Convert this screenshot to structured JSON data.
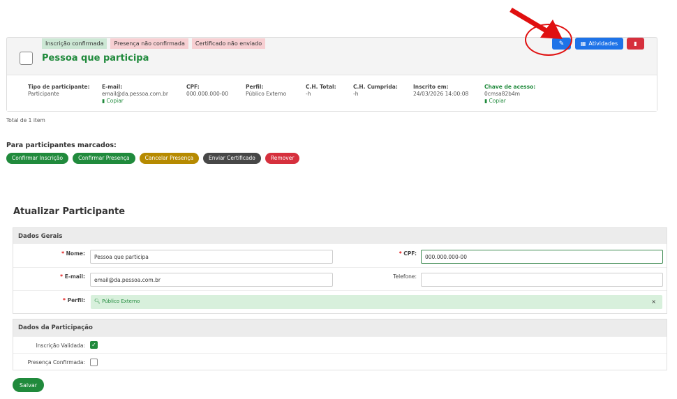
{
  "participant_card": {
    "badges": [
      "Inscrição confirmada",
      "Presença não confirmada",
      "Certificado não enviado"
    ],
    "name": "Pessoa que participa",
    "atividades_label": "Atividades",
    "fields": {
      "tipo": {
        "label": "Tipo de participante:",
        "value": "Participante"
      },
      "email": {
        "label": "E-mail:",
        "value": "email@da.pessoa.com.br",
        "copy": "Copiar"
      },
      "cpf": {
        "label": "CPF:",
        "value": "000.000.000-00"
      },
      "perfil": {
        "label": "Perfil:",
        "value": "Público Externo"
      },
      "ch_total": {
        "label": "C.H. Total:",
        "value": "-h"
      },
      "ch_cumprida": {
        "label": "C.H. Cumprida:",
        "value": "-h"
      },
      "inscrito": {
        "label": "Inscrito em:",
        "value": "24/03/2026 14:00:08"
      },
      "chave": {
        "label": "Chave de acesso:",
        "value": "0cmsa82b4m",
        "copy": "Copiar"
      }
    }
  },
  "total_text": "Total de 1 item",
  "marked": {
    "title": "Para participantes marcados:",
    "actions": [
      "Confirmar Inscrição",
      "Confirmar Presença",
      "Cancelar Presença",
      "Enviar Certificado",
      "Remover"
    ]
  },
  "form": {
    "title": "Atualizar Participante",
    "dados_gerais": "Dados Gerais",
    "nome_label": "Nome:",
    "nome_value": "Pessoa que participa",
    "cpf_label": "CPF:",
    "cpf_value": "000.000.000-00",
    "email_label": "E-mail:",
    "email_value": "email@da.pessoa.com.br",
    "telefone_label": "Telefone:",
    "telefone_value": "",
    "perfil_label": "Perfil:",
    "perfil_value": "Público Externo",
    "dados_participacao": "Dados da Participação",
    "inscricao_label": "Inscrição Validada:",
    "inscricao_checked": true,
    "presenca_label": "Presença Confirmada:",
    "presenca_checked": false,
    "save_label": "Salvar"
  },
  "colors": {
    "accent_green": "#208a3c",
    "primary_blue": "#1e73e8",
    "danger_red": "#d6303d",
    "annotation_red": "#e01010"
  }
}
